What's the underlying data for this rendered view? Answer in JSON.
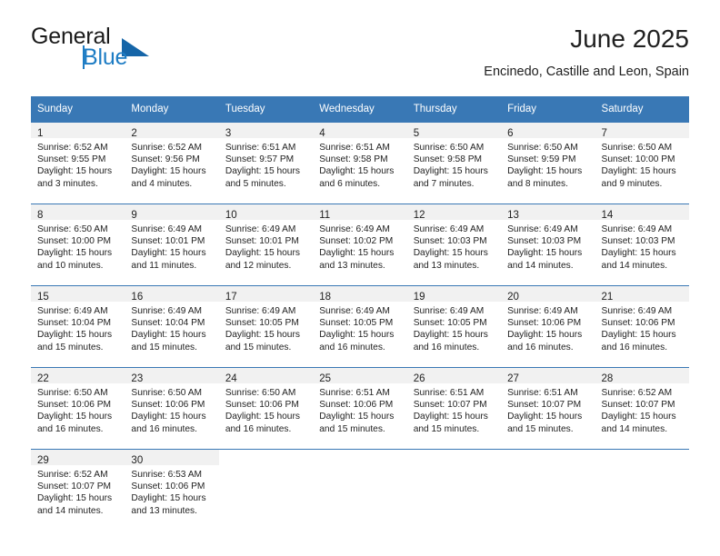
{
  "brand": {
    "word_one": "General",
    "word_two": "Blue",
    "triangle_icon": "triangle-logo-icon",
    "accent_color": "#1d7cc4",
    "dark_color": "#1565a8"
  },
  "header": {
    "month_title": "June 2025",
    "location": "Encinedo, Castille and Leon, Spain"
  },
  "calendar": {
    "header_color": "#3978b5",
    "weekdays": [
      "Sunday",
      "Monday",
      "Tuesday",
      "Wednesday",
      "Thursday",
      "Friday",
      "Saturday"
    ],
    "weeks": [
      [
        {
          "day": "1",
          "sunrise": "Sunrise: 6:52 AM",
          "sunset": "Sunset: 9:55 PM",
          "daylight": "Daylight: 15 hours and 3 minutes."
        },
        {
          "day": "2",
          "sunrise": "Sunrise: 6:52 AM",
          "sunset": "Sunset: 9:56 PM",
          "daylight": "Daylight: 15 hours and 4 minutes."
        },
        {
          "day": "3",
          "sunrise": "Sunrise: 6:51 AM",
          "sunset": "Sunset: 9:57 PM",
          "daylight": "Daylight: 15 hours and 5 minutes."
        },
        {
          "day": "4",
          "sunrise": "Sunrise: 6:51 AM",
          "sunset": "Sunset: 9:58 PM",
          "daylight": "Daylight: 15 hours and 6 minutes."
        },
        {
          "day": "5",
          "sunrise": "Sunrise: 6:50 AM",
          "sunset": "Sunset: 9:58 PM",
          "daylight": "Daylight: 15 hours and 7 minutes."
        },
        {
          "day": "6",
          "sunrise": "Sunrise: 6:50 AM",
          "sunset": "Sunset: 9:59 PM",
          "daylight": "Daylight: 15 hours and 8 minutes."
        },
        {
          "day": "7",
          "sunrise": "Sunrise: 6:50 AM",
          "sunset": "Sunset: 10:00 PM",
          "daylight": "Daylight: 15 hours and 9 minutes."
        }
      ],
      [
        {
          "day": "8",
          "sunrise": "Sunrise: 6:50 AM",
          "sunset": "Sunset: 10:00 PM",
          "daylight": "Daylight: 15 hours and 10 minutes."
        },
        {
          "day": "9",
          "sunrise": "Sunrise: 6:49 AM",
          "sunset": "Sunset: 10:01 PM",
          "daylight": "Daylight: 15 hours and 11 minutes."
        },
        {
          "day": "10",
          "sunrise": "Sunrise: 6:49 AM",
          "sunset": "Sunset: 10:01 PM",
          "daylight": "Daylight: 15 hours and 12 minutes."
        },
        {
          "day": "11",
          "sunrise": "Sunrise: 6:49 AM",
          "sunset": "Sunset: 10:02 PM",
          "daylight": "Daylight: 15 hours and 13 minutes."
        },
        {
          "day": "12",
          "sunrise": "Sunrise: 6:49 AM",
          "sunset": "Sunset: 10:03 PM",
          "daylight": "Daylight: 15 hours and 13 minutes."
        },
        {
          "day": "13",
          "sunrise": "Sunrise: 6:49 AM",
          "sunset": "Sunset: 10:03 PM",
          "daylight": "Daylight: 15 hours and 14 minutes."
        },
        {
          "day": "14",
          "sunrise": "Sunrise: 6:49 AM",
          "sunset": "Sunset: 10:03 PM",
          "daylight": "Daylight: 15 hours and 14 minutes."
        }
      ],
      [
        {
          "day": "15",
          "sunrise": "Sunrise: 6:49 AM",
          "sunset": "Sunset: 10:04 PM",
          "daylight": "Daylight: 15 hours and 15 minutes."
        },
        {
          "day": "16",
          "sunrise": "Sunrise: 6:49 AM",
          "sunset": "Sunset: 10:04 PM",
          "daylight": "Daylight: 15 hours and 15 minutes."
        },
        {
          "day": "17",
          "sunrise": "Sunrise: 6:49 AM",
          "sunset": "Sunset: 10:05 PM",
          "daylight": "Daylight: 15 hours and 15 minutes."
        },
        {
          "day": "18",
          "sunrise": "Sunrise: 6:49 AM",
          "sunset": "Sunset: 10:05 PM",
          "daylight": "Daylight: 15 hours and 16 minutes."
        },
        {
          "day": "19",
          "sunrise": "Sunrise: 6:49 AM",
          "sunset": "Sunset: 10:05 PM",
          "daylight": "Daylight: 15 hours and 16 minutes."
        },
        {
          "day": "20",
          "sunrise": "Sunrise: 6:49 AM",
          "sunset": "Sunset: 10:06 PM",
          "daylight": "Daylight: 15 hours and 16 minutes."
        },
        {
          "day": "21",
          "sunrise": "Sunrise: 6:49 AM",
          "sunset": "Sunset: 10:06 PM",
          "daylight": "Daylight: 15 hours and 16 minutes."
        }
      ],
      [
        {
          "day": "22",
          "sunrise": "Sunrise: 6:50 AM",
          "sunset": "Sunset: 10:06 PM",
          "daylight": "Daylight: 15 hours and 16 minutes."
        },
        {
          "day": "23",
          "sunrise": "Sunrise: 6:50 AM",
          "sunset": "Sunset: 10:06 PM",
          "daylight": "Daylight: 15 hours and 16 minutes."
        },
        {
          "day": "24",
          "sunrise": "Sunrise: 6:50 AM",
          "sunset": "Sunset: 10:06 PM",
          "daylight": "Daylight: 15 hours and 16 minutes."
        },
        {
          "day": "25",
          "sunrise": "Sunrise: 6:51 AM",
          "sunset": "Sunset: 10:06 PM",
          "daylight": "Daylight: 15 hours and 15 minutes."
        },
        {
          "day": "26",
          "sunrise": "Sunrise: 6:51 AM",
          "sunset": "Sunset: 10:07 PM",
          "daylight": "Daylight: 15 hours and 15 minutes."
        },
        {
          "day": "27",
          "sunrise": "Sunrise: 6:51 AM",
          "sunset": "Sunset: 10:07 PM",
          "daylight": "Daylight: 15 hours and 15 minutes."
        },
        {
          "day": "28",
          "sunrise": "Sunrise: 6:52 AM",
          "sunset": "Sunset: 10:07 PM",
          "daylight": "Daylight: 15 hours and 14 minutes."
        }
      ],
      [
        {
          "day": "29",
          "sunrise": "Sunrise: 6:52 AM",
          "sunset": "Sunset: 10:07 PM",
          "daylight": "Daylight: 15 hours and 14 minutes."
        },
        {
          "day": "30",
          "sunrise": "Sunrise: 6:53 AM",
          "sunset": "Sunset: 10:06 PM",
          "daylight": "Daylight: 15 hours and 13 minutes."
        },
        {
          "day": "",
          "sunrise": "",
          "sunset": "",
          "daylight": ""
        },
        {
          "day": "",
          "sunrise": "",
          "sunset": "",
          "daylight": ""
        },
        {
          "day": "",
          "sunrise": "",
          "sunset": "",
          "daylight": ""
        },
        {
          "day": "",
          "sunrise": "",
          "sunset": "",
          "daylight": ""
        },
        {
          "day": "",
          "sunrise": "",
          "sunset": "",
          "daylight": ""
        }
      ]
    ]
  }
}
